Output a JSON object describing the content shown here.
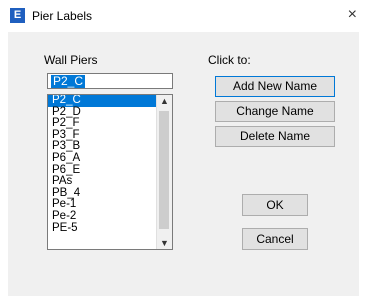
{
  "window": {
    "icon_letter": "E",
    "title": "Pier Labels",
    "close_glyph": "×"
  },
  "left_panel": {
    "label": "Wall Piers",
    "selected_value": "P2_C",
    "items": [
      "P2_C",
      "P2_D",
      "P2_F",
      "P3_F",
      "P3_B",
      "P6_A",
      "P6_E",
      "PAs",
      "PB_4",
      "Pe-1",
      "Pe-2",
      "PE-5"
    ],
    "selected_index": 0
  },
  "right_panel": {
    "label": "Click to:",
    "add_label": "Add New Name",
    "change_label": "Change Name",
    "delete_label": "Delete Name"
  },
  "buttons": {
    "ok_label": "OK",
    "cancel_label": "Cancel"
  },
  "scrollbar": {
    "up_glyph": "▲",
    "down_glyph": "▼"
  },
  "colors": {
    "selection": "#0078d7",
    "app_icon": "#1f5fbf",
    "dialog_bg": "#f0f0f0"
  }
}
